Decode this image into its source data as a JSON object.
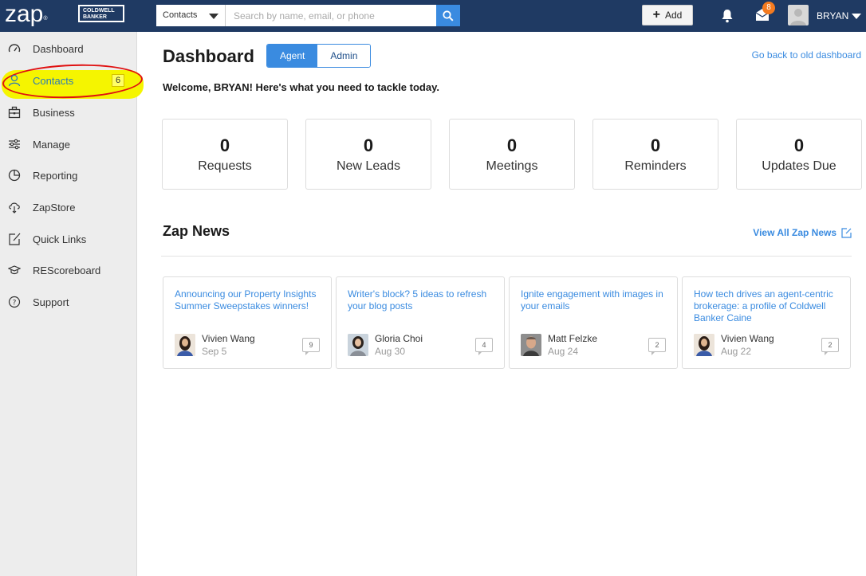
{
  "topbar": {
    "logo": "zap",
    "brand_logo_lines": [
      "COLDWELL",
      "BANKER"
    ],
    "search_scope": "Contacts",
    "search_placeholder": "Search by name, email, or phone",
    "add_label": "Add",
    "inbox_count": "8",
    "user_name": "BRYAN"
  },
  "sidebar": {
    "items": [
      {
        "label": "Dashboard",
        "icon": "gauge-icon"
      },
      {
        "label": "Contacts",
        "icon": "person-icon",
        "badge": "6",
        "active": true
      },
      {
        "label": "Business",
        "icon": "briefcase-icon"
      },
      {
        "label": "Manage",
        "icon": "sliders-icon"
      },
      {
        "label": "Reporting",
        "icon": "pie-chart-icon"
      },
      {
        "label": "ZapStore",
        "icon": "cloud-download-icon"
      },
      {
        "label": "Quick Links",
        "icon": "external-link-icon"
      },
      {
        "label": "REScoreboard",
        "icon": "graduation-cap-icon"
      },
      {
        "label": "Support",
        "icon": "question-icon"
      }
    ]
  },
  "main": {
    "title": "Dashboard",
    "toggle": {
      "agent": "Agent",
      "admin": "Admin"
    },
    "old_dashboard_link": "Go back to old dashboard",
    "welcome": "Welcome, BRYAN! Here's what you need to tackle today.",
    "stats": [
      {
        "value": "0",
        "label": "Requests"
      },
      {
        "value": "0",
        "label": "New Leads"
      },
      {
        "value": "0",
        "label": "Meetings"
      },
      {
        "value": "0",
        "label": "Reminders"
      },
      {
        "value": "0",
        "label": "Updates Due"
      }
    ],
    "news_title": "Zap News",
    "news_all_link": "View All Zap News",
    "news": [
      {
        "title": "Announcing our Property Insights Summer Sweepstakes winners!",
        "author": "Vivien Wang",
        "date": "Sep 5",
        "comments": "9"
      },
      {
        "title": "Writer's block? 5 ideas to refresh your blog posts",
        "author": "Gloria Choi",
        "date": "Aug 30",
        "comments": "4"
      },
      {
        "title": "Ignite engagement with images in your emails",
        "author": "Matt Felzke",
        "date": "Aug 24",
        "comments": "2"
      },
      {
        "title": "How tech drives an agent-centric brokerage: a profile of Coldwell Banker Caine",
        "author": "Vivien Wang",
        "date": "Aug 22",
        "comments": "2"
      }
    ]
  },
  "colors": {
    "topbar": "#1f3a63",
    "accent": "#3a8be0",
    "sidebar_bg": "#ededed",
    "highlight": "#f5f500",
    "annotation_circle": "#e01010"
  }
}
